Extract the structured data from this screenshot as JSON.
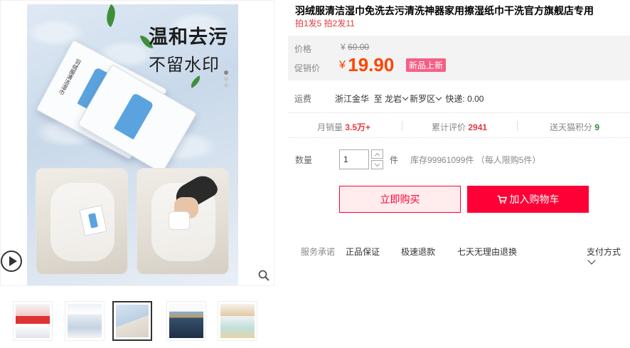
{
  "product": {
    "title": "羽绒服清洁湿巾免洗去污清洗神器家用擦湿纸巾干洗官方旗舰店专用",
    "subtitle": "拍1发5 拍2发11",
    "image": {
      "slogan_line1": "温和去污",
      "slogan_line2": "不留水印",
      "pack_text": "羽绒服清洁湿巾"
    }
  },
  "price": {
    "price_label": "价格",
    "currency": "¥",
    "original": "60.00",
    "promo_label": "促销价",
    "promo": "19.90",
    "badge": "新品上新"
  },
  "shipping": {
    "label": "运费",
    "from": "浙江金华",
    "to_label": "至",
    "city": "龙岩",
    "district": "新罗区",
    "express": "快递: 0.00"
  },
  "stats": {
    "monthly_sales_label": "月销量",
    "monthly_sales": "3.5万+",
    "reviews_label": "累计评价",
    "reviews": "2941",
    "points_label": "送天猫积分",
    "points": "9"
  },
  "purchase": {
    "qty_label": "数量",
    "qty_value": "1",
    "unit": "件",
    "stock": "库存99961099件 （每人限购5件）",
    "buy_now": "立即购买",
    "add_cart": "加入购物车"
  },
  "service": {
    "label": "服务承诺",
    "items": [
      "正品保证",
      "极速退款",
      "七天无理由退换"
    ],
    "payment": "支付方式"
  },
  "gallery": {
    "thumbnail_count": 5,
    "active_thumbnail": 3,
    "slide_dots": 3,
    "icons": [
      "play-icon",
      "zoom-icon",
      "cart-icon"
    ]
  },
  "colors": {
    "accent": "#ff0036",
    "price": "#ff4400",
    "badge": "#f55f86",
    "points": "#2f8a3b"
  }
}
